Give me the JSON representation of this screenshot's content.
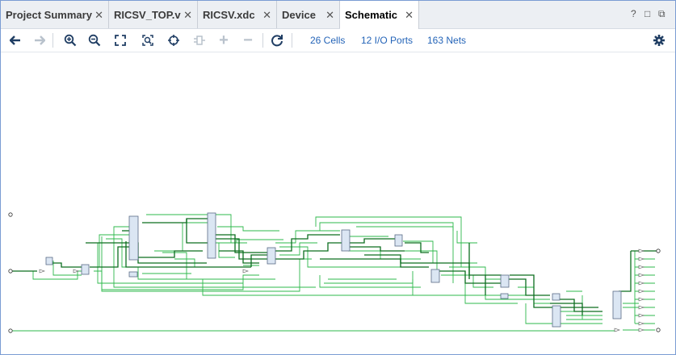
{
  "tabs": [
    {
      "label": "Project Summary",
      "active": false
    },
    {
      "label": "RICSV_TOP.v",
      "active": false
    },
    {
      "label": "RICSV.xdc",
      "active": false
    },
    {
      "label": "Device",
      "active": false
    },
    {
      "label": "Schematic",
      "active": true
    }
  ],
  "window_controls": {
    "help": "?",
    "restore": "□",
    "float": "⧉"
  },
  "toolbar": {
    "icons": [
      "back-arrow-icon",
      "forward-arrow-icon",
      "zoom-in-icon",
      "zoom-out-icon",
      "zoom-fit-icon",
      "zoom-area-icon",
      "select-target-icon",
      "expand-icon",
      "add-icon",
      "remove-icon",
      "refresh-icon",
      "settings-icon"
    ],
    "stats": {
      "cells": "26 Cells",
      "ports": "12 I/O Ports",
      "nets": "163 Nets"
    }
  },
  "colors": {
    "net": "#2db84b",
    "net_dark": "#0c6e1f",
    "cell_fill": "#dbe6f3",
    "cell_stroke": "#5a6b86"
  }
}
